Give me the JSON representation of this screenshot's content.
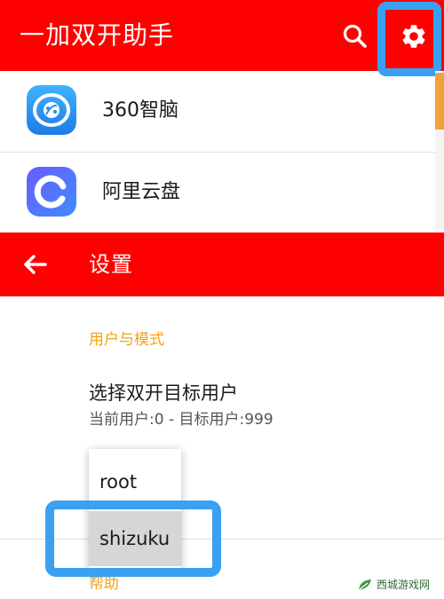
{
  "appbar": {
    "title": "一加双开助手",
    "search_icon": "search-icon",
    "settings_icon": "gear-icon"
  },
  "apps": [
    {
      "name": "360智脑",
      "icon": "360-brain-app-icon"
    },
    {
      "name": "阿里云盘",
      "icon": "aliyun-drive-app-icon"
    }
  ],
  "settings": {
    "title": "设置",
    "back_icon": "arrow-left-icon",
    "section_user_mode": "用户与模式",
    "pref_target_user": {
      "title": "选择双开目标用户",
      "summary": "当前用户:0  -  目标用户:999"
    },
    "section_next": "帮助"
  },
  "popup_menu": {
    "items": [
      "root",
      "shizuku"
    ],
    "selected": "shizuku"
  },
  "watermark": {
    "text": "西城游戏网"
  },
  "colors": {
    "appbar_red": "#ff0000",
    "accent_orange": "#f2a41a",
    "highlight_blue": "#3aa0f2",
    "scroll_thumb": "#f0a33a"
  }
}
